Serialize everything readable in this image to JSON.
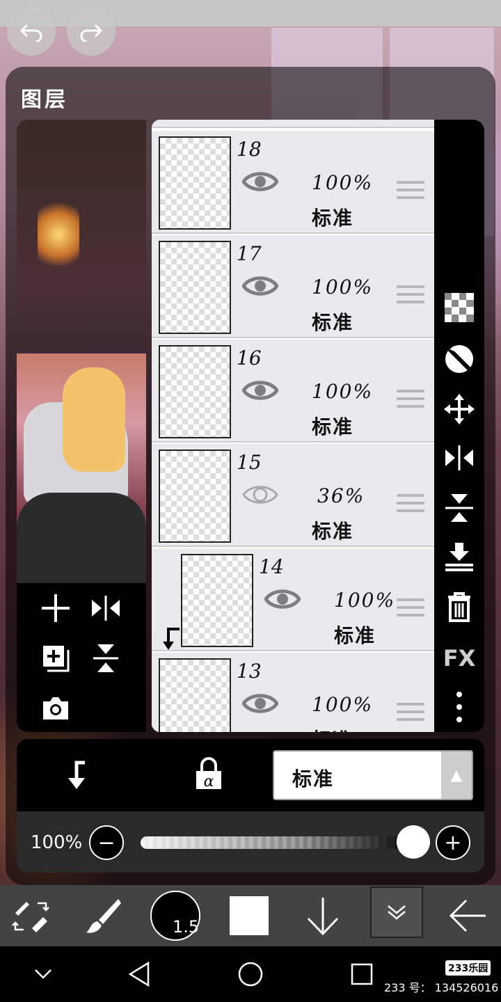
{
  "panel": {
    "title": "图层"
  },
  "layers": [
    {
      "num": "18",
      "opacity": "100%",
      "mode": "标准",
      "visible": true
    },
    {
      "num": "17",
      "opacity": "100%",
      "mode": "标准",
      "visible": true
    },
    {
      "num": "16",
      "opacity": "100%",
      "mode": "标准",
      "visible": true
    },
    {
      "num": "15",
      "opacity": "36%",
      "mode": "标准",
      "visible": false
    },
    {
      "num": "14",
      "opacity": "100%",
      "mode": "标准",
      "visible": true,
      "clipped": true
    },
    {
      "num": "13",
      "opacity": "100%",
      "mode": "标准",
      "visible": true
    }
  ],
  "right_tools": [
    "checker-icon",
    "circle-half-icon",
    "move-icon",
    "flip-horizontal-icon",
    "flip-vertical-icon",
    "merge-down-icon",
    "trash-icon",
    "fx-icon",
    "more-icon"
  ],
  "fx_label": "FX",
  "blend": {
    "value": "标准"
  },
  "opacity": {
    "label": "100%",
    "value": 100
  },
  "brush": {
    "size": "1.5"
  },
  "colors": {
    "swatch": "#ffffff",
    "panel": "#000000",
    "list_bg": "#e9e9ee"
  },
  "watermark": {
    "badge": "233乐园",
    "text": "233 号： 134526016"
  }
}
